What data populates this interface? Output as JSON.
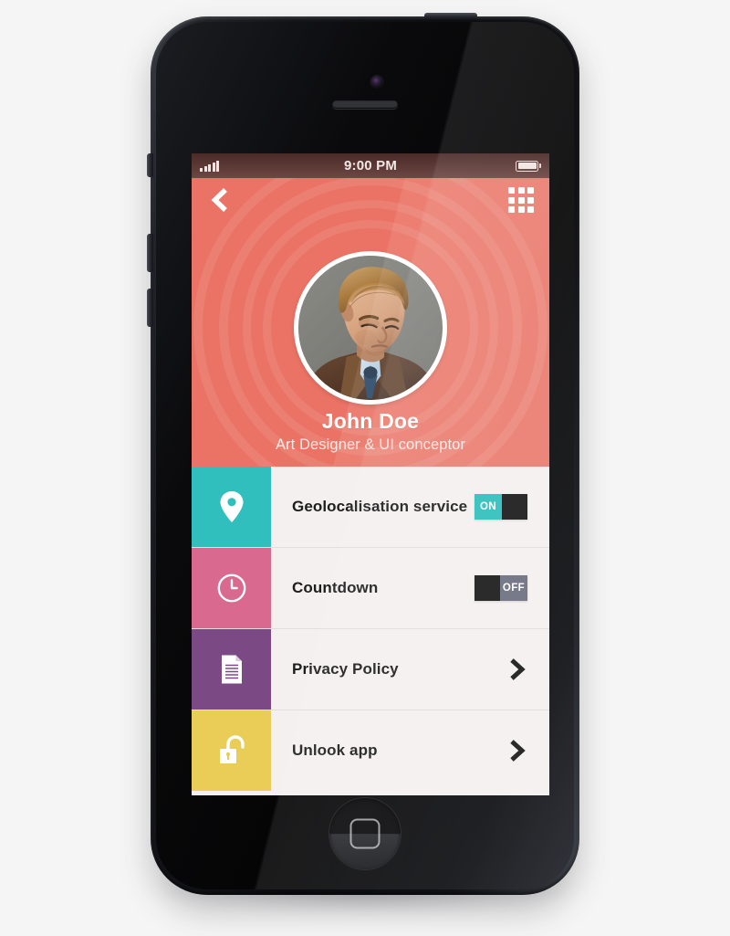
{
  "device": {
    "type": "smartphone-mockup",
    "hardware": {
      "earpiece": "earpiece-speaker",
      "camera": "front-camera",
      "home_button": "home-button",
      "mute_switch": "mute-switch",
      "volume_up": "volume-up",
      "volume_down": "volume-down",
      "power_button": "power-button"
    }
  },
  "status_bar": {
    "signal_icon": "signal-bars-icon",
    "signal_bars_filled": 5,
    "signal_bars_total": 5,
    "time": "9:00 PM",
    "battery_icon": "battery-icon",
    "battery_level_percent": 100,
    "background_color": "#5d3a36",
    "text_color": "#f3e8e6"
  },
  "nav_bar": {
    "back_icon": "chevron-left-icon",
    "menu_icon": "grid-menu-icon",
    "menu_dots": 9
  },
  "profile": {
    "name": "John Doe",
    "role": "Art Designer & UI conceptor",
    "avatar_icon": "avatar",
    "avatar_alt": "portrait of a man in a brown leather jacket looking down",
    "header_color": "#ea7365",
    "ripple_rings": 4
  },
  "settings": {
    "rows": [
      {
        "label": "Geolocalisation service",
        "icon": "location-pin-icon",
        "tile_color": "#31bfbd",
        "control": "toggle",
        "toggle_state": "ON",
        "toggle_label": "ON"
      },
      {
        "label": "Countdown",
        "icon": "clock-icon",
        "tile_color": "#d9698f",
        "control": "toggle",
        "toggle_state": "OFF",
        "toggle_label": "OFF"
      },
      {
        "label": "Privacy Policy",
        "icon": "document-icon",
        "tile_color": "#7b4a85",
        "control": "chevron",
        "chevron_icon": "chevron-right-icon"
      },
      {
        "label": "Unlook app",
        "icon": "unlock-padlock-icon",
        "tile_color": "#e9cd57",
        "control": "chevron",
        "chevron_icon": "chevron-right-icon"
      }
    ],
    "row_background_color": "#f4f0f0",
    "label_color": "#1d1d1d"
  }
}
